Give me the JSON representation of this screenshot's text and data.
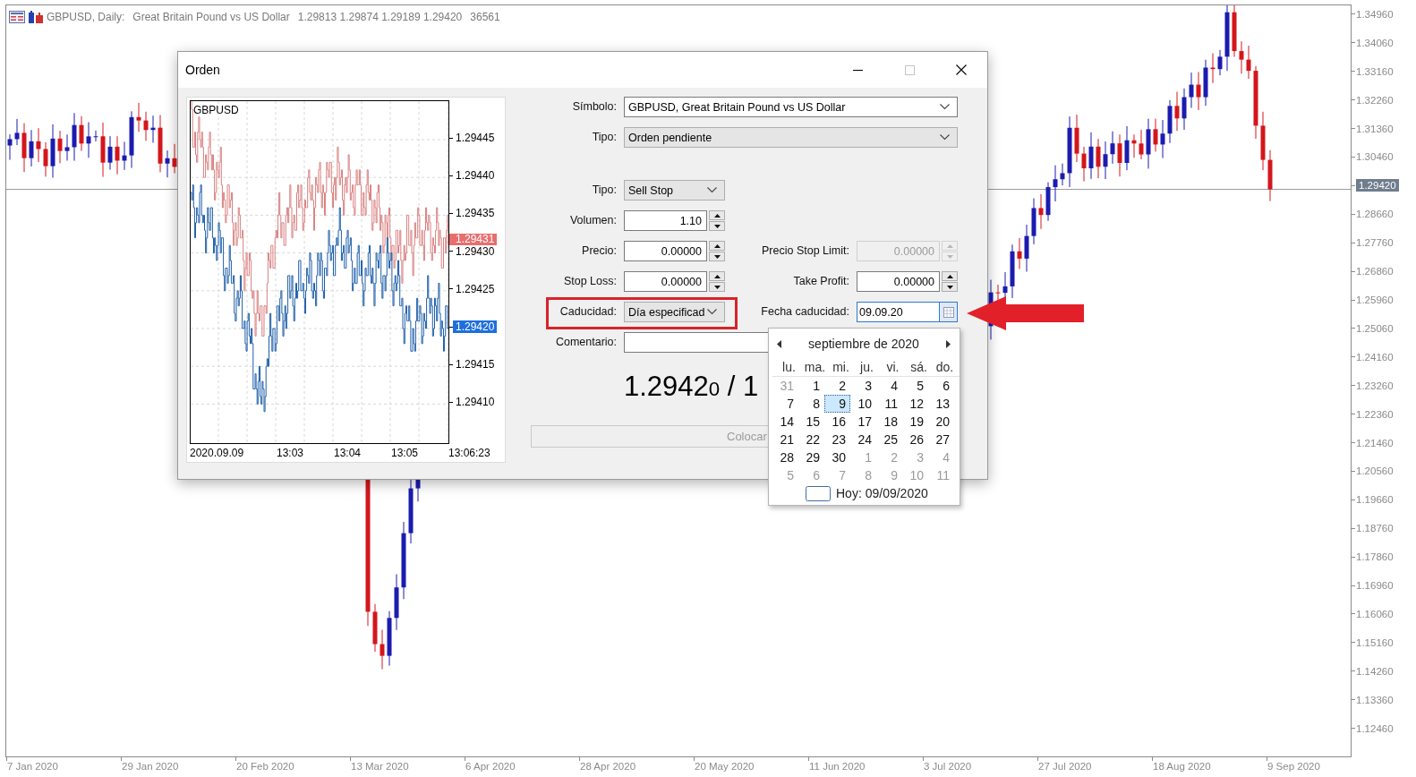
{
  "chart": {
    "header": {
      "symbol_period": "GBPUSD, Daily:",
      "description": "Great Britain Pound vs US Dollar",
      "ohlc": "1.29813 1.29874 1.29189 1.29420",
      "volume": "36561"
    },
    "price_axis": {
      "ticks_above": [
        "1.34960",
        "1.34060",
        "1.33160",
        "1.32260",
        "1.31360",
        "1.30460"
      ],
      "current_price": "1.29420",
      "ticks_below": [
        "1.28660",
        "1.27760",
        "1.26860",
        "1.25960",
        "1.25060",
        "1.24160",
        "1.23260",
        "1.22360",
        "1.21460",
        "1.20560",
        "1.19660",
        "1.18760",
        "1.17860",
        "1.16960",
        "1.16060",
        "1.15160",
        "1.14260",
        "1.13360",
        "1.12460"
      ]
    },
    "date_axis": [
      "7 Jan 2020",
      "29 Jan 2020",
      "20 Feb 2020",
      "13 Mar 2020",
      "6 Apr 2020",
      "28 Apr 2020",
      "20 May 2020",
      "11 Jun 2020",
      "3 Jul 2020",
      "27 Jul 2020",
      "18 Aug 2020",
      "9 Sep 2020"
    ]
  },
  "dialog": {
    "title": "Orden",
    "preview": {
      "symbol": "GBPUSD",
      "ask_price": "1.29431",
      "y_ticks": [
        {
          "kind": "tick",
          "label": "1.29445"
        },
        {
          "kind": "tick",
          "label": "1.29440"
        },
        {
          "kind": "tick",
          "label": "1.29435"
        },
        {
          "kind": "tick",
          "label": "1.29430"
        },
        {
          "kind": "tick",
          "label": "1.29425"
        },
        {
          "kind": "bid",
          "label": "1.29420"
        },
        {
          "kind": "tick",
          "label": "1.29415"
        },
        {
          "kind": "tick",
          "label": "1.29410"
        }
      ],
      "x_ticks": [
        "2020.09.09",
        "13:03",
        "13:04",
        "13:05",
        "13:06:23"
      ]
    },
    "form": {
      "symbol": {
        "label": "Símbolo:",
        "value": "GBPUSD, Great Britain Pound vs US Dollar"
      },
      "type": {
        "label": "Tipo:",
        "value": "Orden pendiente"
      },
      "order_type": {
        "label": "Tipo:",
        "value": "Sell Stop"
      },
      "volume": {
        "label": "Volumen:",
        "value": "1.10"
      },
      "price": {
        "label": "Precio:",
        "value": "0.00000"
      },
      "stop_limit_price": {
        "label": "Precio Stop Limit:",
        "value": "0.00000",
        "disabled": true
      },
      "stop_loss": {
        "label": "Stop Loss:",
        "value": "0.00000"
      },
      "take_profit": {
        "label": "Take Profit:",
        "value": "0.00000"
      },
      "expiration": {
        "label": "Caducidad:",
        "value": "Día especificad"
      },
      "expiration_date": {
        "label": "Fecha caducidad:",
        "value": "09.09.20",
        "focused": true
      },
      "comment": {
        "label": "Comentario:"
      },
      "quote": "1.2942$_{0}$ / 1",
      "place_button": {
        "label": "Colocar",
        "disabled": true
      }
    },
    "calendar": {
      "month": "septiembre de 2020",
      "weekdays": [
        "lu.",
        "ma.",
        "mi.",
        "ju.",
        "vi.",
        "sá.",
        "do."
      ],
      "days": [
        {
          "label": "31",
          "in_month": false,
          "selected": false
        },
        {
          "label": "1",
          "in_month": true,
          "selected": false
        },
        {
          "label": "2",
          "in_month": true,
          "selected": false
        },
        {
          "label": "3",
          "in_month": true,
          "selected": false
        },
        {
          "label": "4",
          "in_month": true,
          "selected": false
        },
        {
          "label": "5",
          "in_month": true,
          "selected": false
        },
        {
          "label": "6",
          "in_month": true,
          "selected": false
        },
        {
          "label": "7",
          "in_month": true,
          "selected": false
        },
        {
          "label": "8",
          "in_month": true,
          "selected": false
        },
        {
          "label": "9",
          "in_month": true,
          "selected": true
        },
        {
          "label": "10",
          "in_month": true,
          "selected": false
        },
        {
          "label": "11",
          "in_month": true,
          "selected": false
        },
        {
          "label": "12",
          "in_month": true,
          "selected": false
        },
        {
          "label": "13",
          "in_month": true,
          "selected": false
        },
        {
          "label": "14",
          "in_month": true,
          "selected": false
        },
        {
          "label": "15",
          "in_month": true,
          "selected": false
        },
        {
          "label": "16",
          "in_month": true,
          "selected": false
        },
        {
          "label": "17",
          "in_month": true,
          "selected": false
        },
        {
          "label": "18",
          "in_month": true,
          "selected": false
        },
        {
          "label": "19",
          "in_month": true,
          "selected": false
        },
        {
          "label": "20",
          "in_month": true,
          "selected": false
        },
        {
          "label": "21",
          "in_month": true,
          "selected": false
        },
        {
          "label": "22",
          "in_month": true,
          "selected": false
        },
        {
          "label": "23",
          "in_month": true,
          "selected": false
        },
        {
          "label": "24",
          "in_month": true,
          "selected": false
        },
        {
          "label": "25",
          "in_month": true,
          "selected": false
        },
        {
          "label": "26",
          "in_month": true,
          "selected": false
        },
        {
          "label": "27",
          "in_month": true,
          "selected": false
        },
        {
          "label": "28",
          "in_month": true,
          "selected": false
        },
        {
          "label": "29",
          "in_month": true,
          "selected": false
        },
        {
          "label": "30",
          "in_month": true,
          "selected": false
        },
        {
          "label": "1",
          "in_month": false,
          "selected": false
        },
        {
          "label": "2",
          "in_month": false,
          "selected": false
        },
        {
          "label": "3",
          "in_month": false,
          "selected": false
        },
        {
          "label": "4",
          "in_month": false,
          "selected": false
        },
        {
          "label": "5",
          "in_month": false,
          "selected": false
        },
        {
          "label": "6",
          "in_month": false,
          "selected": false
        },
        {
          "label": "7",
          "in_month": false,
          "selected": false
        },
        {
          "label": "8",
          "in_month": false,
          "selected": false
        },
        {
          "label": "9",
          "in_month": false,
          "selected": false
        },
        {
          "label": "10",
          "in_month": false,
          "selected": false
        },
        {
          "label": "11",
          "in_month": false,
          "selected": false
        }
      ],
      "today": "Hoy: 09/09/2020"
    }
  }
}
